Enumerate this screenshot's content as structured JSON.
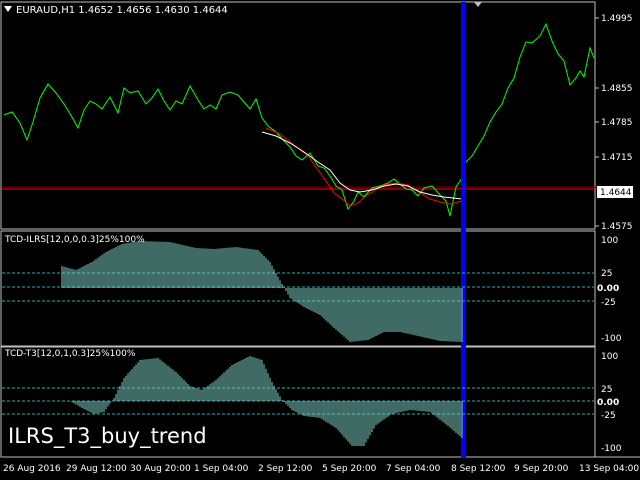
{
  "main_chart": {
    "symbol_header": "EURAUD,H1  1.4652 1.4656 1.4630 1.4644",
    "price_ticks": [
      "1.4995",
      "1.4855",
      "1.4785",
      "1.4715",
      "1.4575"
    ],
    "current_price": "1.4644",
    "colors": {
      "price": "#00ff00",
      "ma": "#ff0000",
      "hline": "#ff0000",
      "cursor": "#0000ff"
    }
  },
  "indicator1": {
    "label": "TCD-ILRS[12,0,0,0.3]25%100%",
    "ticks": [
      "100",
      "25",
      "0.00",
      "-25",
      "-100"
    ]
  },
  "indicator2": {
    "label": "TCD-T3[12,0,1,0.3]25%100%",
    "ticks": [
      "100",
      "25",
      "0.00",
      "-25",
      "-100"
    ]
  },
  "time_axis": [
    "26 Aug 2016",
    "29 Aug 12:00",
    "30 Aug 20:00",
    "1 Sep 04:00",
    "2 Sep 12:00",
    "5 Sep 20:00",
    "7 Sep 04:00",
    "8 Sep 12:00",
    "9 Sep 20:00",
    "13 Sep 04:00"
  ],
  "overlay_title": "ILRS_T3_buy_trend",
  "chart_data": {
    "type": "line",
    "title": "EURAUD,H1",
    "ylim": [
      1.4575,
      1.4995
    ],
    "current_price_line": 1.4644,
    "series": [
      {
        "name": "EURAUD",
        "values": [
          1.482,
          1.481,
          1.479,
          1.474,
          1.479,
          1.484,
          1.488,
          1.483,
          1.484,
          1.48,
          1.478,
          1.483,
          1.487,
          1.483,
          1.482,
          1.486,
          1.485,
          1.484,
          1.486,
          1.482,
          1.479,
          1.481,
          1.486,
          1.484,
          1.477,
          1.473,
          1.47,
          1.468,
          1.466,
          1.462,
          1.459,
          1.462,
          1.465,
          1.466,
          1.463,
          1.465,
          1.464,
          1.46,
          1.463,
          1.471,
          1.478,
          1.486,
          1.494,
          1.497,
          1.491,
          1.488,
          1.492,
          1.49
        ]
      }
    ]
  }
}
